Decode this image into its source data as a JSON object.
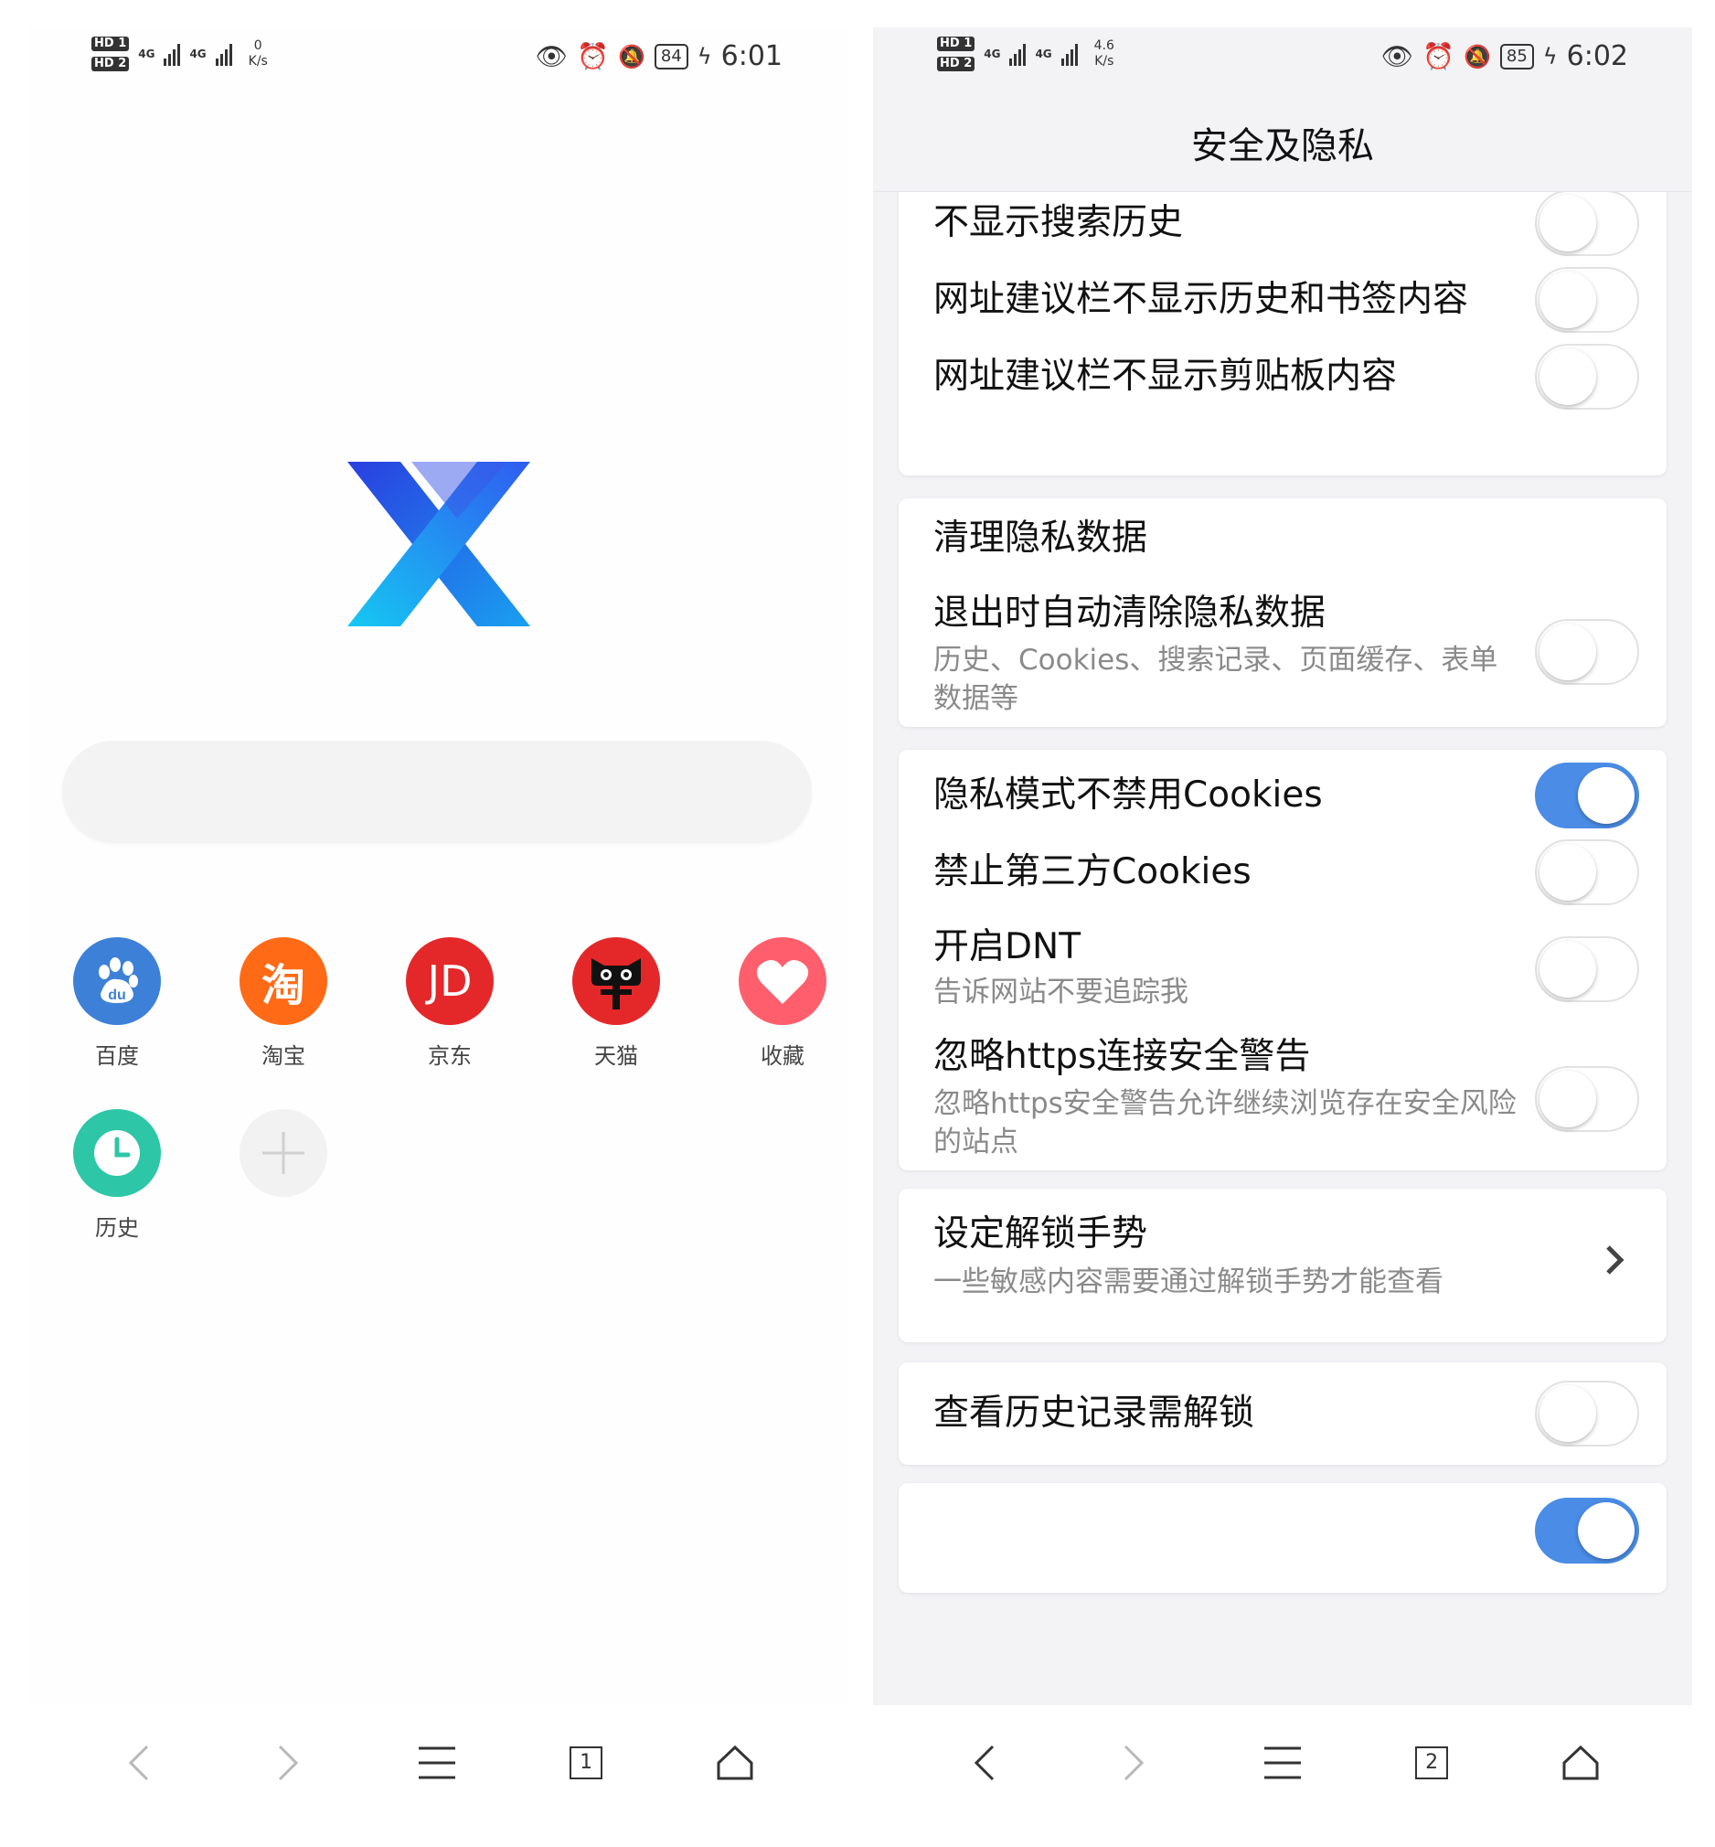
{
  "left": {
    "status": {
      "net_speed": "0",
      "net_unit": "K/s",
      "battery": "84",
      "time": "6:01"
    },
    "shortcuts": [
      {
        "label": "百度",
        "icon": "baidu-icon",
        "color": "#3d80d8"
      },
      {
        "label": "淘宝",
        "icon": "taobao-icon",
        "color": "#ff6a16",
        "glyph": "淘"
      },
      {
        "label": "京东",
        "icon": "jd-icon",
        "color": "#e4282a",
        "glyph": "JD"
      },
      {
        "label": "天猫",
        "icon": "tmall-icon",
        "color": "#e4282a"
      },
      {
        "label": "收藏",
        "icon": "favorite-icon",
        "color": "#ff5e6c"
      },
      {
        "label": "历史",
        "icon": "history-icon",
        "color": "#2dc6a6"
      }
    ],
    "tab_count": "1"
  },
  "right": {
    "status": {
      "net_speed": "4.6",
      "net_unit": "K/s",
      "battery": "85",
      "time": "6:02"
    },
    "title": "安全及隐私",
    "group1": [
      {
        "title": "不显示搜索历史",
        "on": false
      },
      {
        "title": "网址建议栏不显示历史和书签内容",
        "on": false
      },
      {
        "title": "网址建议栏不显示剪贴板内容",
        "on": false
      }
    ],
    "clear_section": {
      "title": "清理隐私数据",
      "auto_clear": {
        "title": "退出时自动清除隐私数据",
        "subtitle": "历史、Cookies、搜索记录、页面缓存、表单数据等",
        "on": false
      }
    },
    "group3": [
      {
        "title": "隐私模式不禁用Cookies",
        "on": true
      },
      {
        "title": "禁止第三方Cookies",
        "on": false
      },
      {
        "title": "开启DNT",
        "subtitle": "告诉网站不要追踪我",
        "on": false
      },
      {
        "title": "忽略https连接安全警告",
        "subtitle": "忽略https安全警告允许继续浏览存在安全风险的站点",
        "on": false
      }
    ],
    "gesture": {
      "title": "设定解锁手势",
      "subtitle": "一些敏感内容需要通过解锁手势才能查看"
    },
    "history_lock": {
      "title": "查看历史记录需解锁",
      "on": false
    },
    "tab_count": "2"
  }
}
